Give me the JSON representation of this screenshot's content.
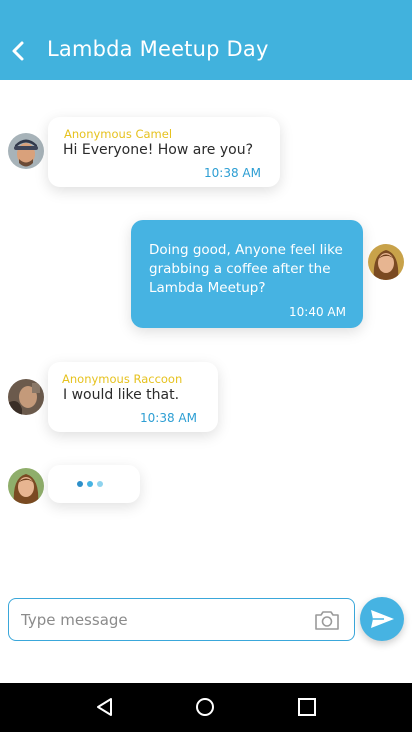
{
  "header": {
    "title": "Lambda Meetup Day",
    "back_icon": "back-chevron",
    "background": "#41b2dd"
  },
  "messages": [
    {
      "direction": "incoming",
      "sender": "Anonymous Camel",
      "lines": [
        "Hi Everyone! How are you?"
      ],
      "time": "10:38 AM",
      "avatar": "man-with-cap"
    },
    {
      "direction": "outgoing",
      "lines": [
        "Doing good, Anyone feel like",
        "grabbing a coffee after the",
        "Lambda Meetup?"
      ],
      "time": "10:40 AM",
      "avatar": "woman-brown-hair"
    },
    {
      "direction": "incoming",
      "sender": "Anonymous Raccoon",
      "lines": [
        "I would like that."
      ],
      "time": "10:38 AM",
      "avatar": "person-dark"
    }
  ],
  "typing_indicator": {
    "avatar": "woman-brown-hair",
    "dot_colors": [
      "#2d8fc9",
      "#46b3e2",
      "#8fd3ee"
    ]
  },
  "composer": {
    "placeholder": "Type message",
    "camera_icon": "camera-icon",
    "send_icon": "send-icon"
  },
  "system_nav": {
    "back": "nav-back-icon",
    "home": "nav-home-icon",
    "recents": "nav-recents-icon"
  },
  "colors": {
    "accent": "#41b2dd",
    "sender_name": "#e6c21f",
    "timestamp": "#2d9ed3"
  }
}
